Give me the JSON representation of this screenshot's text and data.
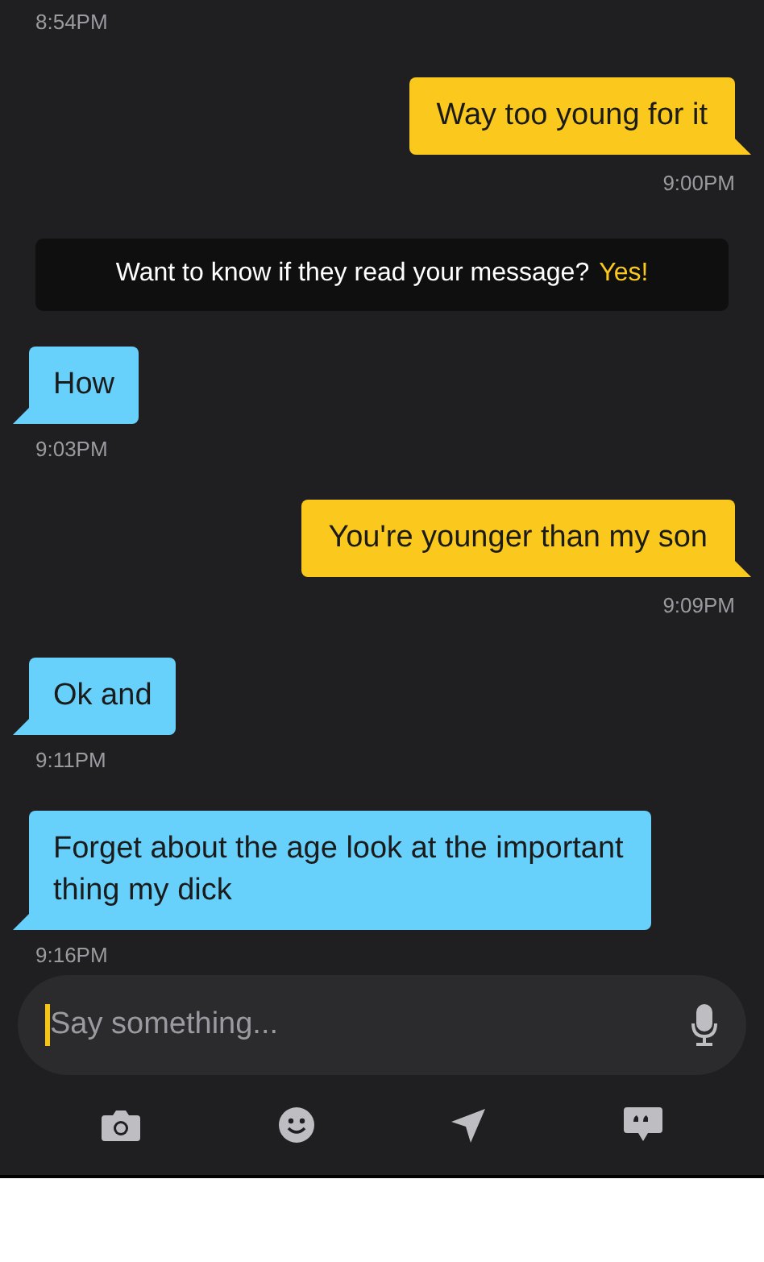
{
  "messages": [
    {
      "kind": "time_only",
      "time": "8:54PM"
    },
    {
      "kind": "sent",
      "text": "Way too young for it",
      "time": "9:00PM"
    },
    {
      "kind": "banner",
      "text": "Want to know if they read your message?",
      "link": "Yes!"
    },
    {
      "kind": "received",
      "text": "How",
      "time": "9:03PM"
    },
    {
      "kind": "sent",
      "text": "You're younger than my son",
      "time": "9:09PM"
    },
    {
      "kind": "received",
      "text": "Ok and",
      "time": "9:11PM"
    },
    {
      "kind": "received",
      "text": "Forget about the age look at the important thing my dick",
      "time": "9:16PM"
    }
  ],
  "composer": {
    "placeholder": "Say something..."
  }
}
